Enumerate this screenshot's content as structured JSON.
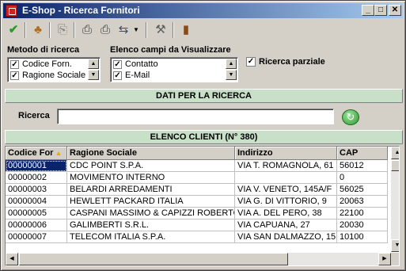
{
  "window": {
    "title": "E-Shop - Ricerca Fornitori"
  },
  "titlebar_buttons": {
    "minimize": "_",
    "maximize": "□",
    "close": "✕"
  },
  "toolbar": {
    "icons": [
      "check-icon",
      "users-icon",
      "copy-icon",
      "print-icon",
      "print-preview-icon",
      "export-icon",
      "tools-icon",
      "exit-door-icon"
    ]
  },
  "search_method": {
    "label": "Metodo di ricerca",
    "options": [
      {
        "label": "Codice Forn.",
        "checked": true
      },
      {
        "label": "Ragione Sociale",
        "checked": true
      }
    ]
  },
  "display_fields": {
    "label": "Elenco campi da Visualizzare",
    "options": [
      {
        "label": "Contatto",
        "checked": true
      },
      {
        "label": "E-Mail",
        "checked": true
      }
    ]
  },
  "partial_search": {
    "label": "Ricerca parziale",
    "checked": true
  },
  "search_section": {
    "title": "DATI PER LA RICERCA",
    "label": "Ricerca",
    "value": ""
  },
  "clients_section": {
    "title": "ELENCO CLIENTI (N° 380)"
  },
  "grid": {
    "columns": [
      "Codice For",
      "Ragione Sociale",
      "Indirizzo",
      "CAP"
    ],
    "rows": [
      [
        "00000001",
        "CDC POINT S.P.A.",
        "VIA T. ROMAGNOLA, 61",
        "56012"
      ],
      [
        "00000002",
        "MOVIMENTO INTERNO",
        "",
        "0"
      ],
      [
        "00000003",
        "BELARDI ARREDAMENTI",
        "VIA V. VENETO, 145A/F",
        "56025"
      ],
      [
        "00000004",
        "HEWLETT PACKARD ITALIA",
        "VIA G. DI VITTORIO, 9",
        "20063"
      ],
      [
        "00000005",
        "CASPANI MASSIMO & CAPIZZI ROBERTO",
        "VIA A. DEL PERO, 38",
        "22100"
      ],
      [
        "00000006",
        "GALIMBERTI S.R.L.",
        "VIA CAPUANA, 27",
        "20030"
      ],
      [
        "00000007",
        "TELECOM ITALIA S.P.A.",
        "VIA SAN DALMAZZO, 15",
        "10100"
      ]
    ]
  },
  "colors": {
    "title_gradient_start": "#0a246a",
    "section_bar": "#c8e0c8",
    "selection": "#0a246a"
  }
}
